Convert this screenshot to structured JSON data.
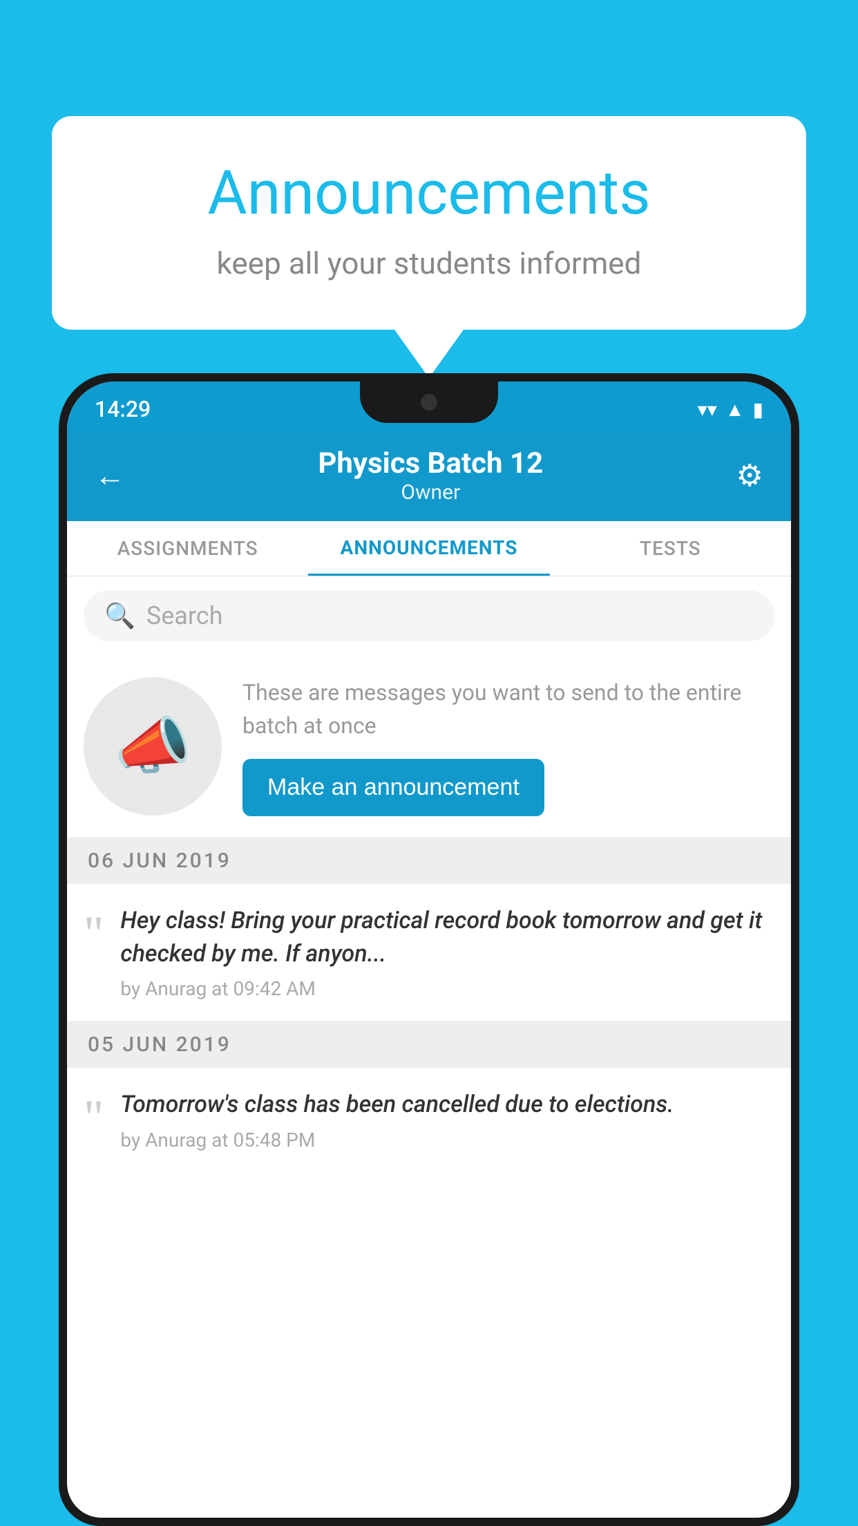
{
  "background_color": "#1BBBEA",
  "speech_bubble": {
    "title": "Announcements",
    "subtitle": "keep all your students informed"
  },
  "status_bar": {
    "time": "14:29",
    "icons": [
      "wifi",
      "signal",
      "battery"
    ]
  },
  "header": {
    "title": "Physics Batch 12",
    "subtitle": "Owner",
    "back_label": "←",
    "gear_label": "⚙"
  },
  "tabs": [
    {
      "label": "ASSIGNMENTS",
      "active": false
    },
    {
      "label": "ANNOUNCEMENTS",
      "active": true
    },
    {
      "label": "TESTS",
      "active": false
    }
  ],
  "search": {
    "placeholder": "Search"
  },
  "announcement_intro": {
    "description": "These are messages you want to send to the entire batch at once",
    "button_label": "Make an announcement"
  },
  "announcement_list": [
    {
      "date": "06  JUN  2019",
      "text": "Hey class! Bring your practical record book tomorrow and get it checked by me. If anyon...",
      "meta": "by Anurag at 09:42 AM"
    },
    {
      "date": "05  JUN  2019",
      "text": "Tomorrow's class has been cancelled due to elections.",
      "meta": "by Anurag at 05:48 PM"
    }
  ]
}
